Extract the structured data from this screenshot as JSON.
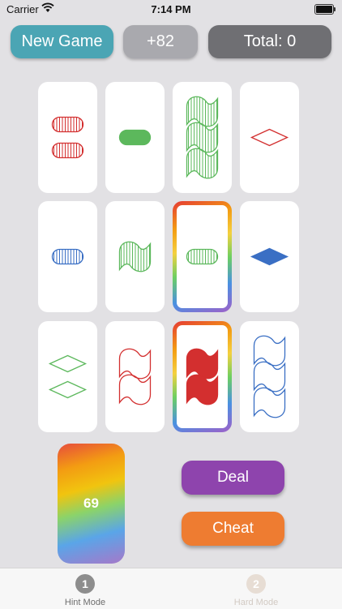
{
  "status_bar": {
    "carrier": "Carrier",
    "time": "7:14 PM"
  },
  "top_bar": {
    "new_game": "New Game",
    "score": "+82",
    "total": "Total: 0"
  },
  "cards": [
    {
      "color": "#d32f2f",
      "shape": "oval",
      "count": 2,
      "fill": "striped",
      "selected": false
    },
    {
      "color": "#5cb85c",
      "shape": "oval",
      "count": 1,
      "fill": "solid",
      "selected": false
    },
    {
      "color": "#5cb85c",
      "shape": "squiggle",
      "count": 3,
      "fill": "striped",
      "selected": false
    },
    {
      "color": "#d32f2f",
      "shape": "diamond",
      "count": 1,
      "fill": "open",
      "selected": false
    },
    {
      "color": "#3a6fc4",
      "shape": "oval",
      "count": 1,
      "fill": "striped",
      "selected": false
    },
    {
      "color": "#5cb85c",
      "shape": "squiggle",
      "count": 1,
      "fill": "striped",
      "selected": false
    },
    {
      "color": "#5cb85c",
      "shape": "oval",
      "count": 1,
      "fill": "striped",
      "selected": true
    },
    {
      "color": "#3a6fc4",
      "shape": "diamond",
      "count": 1,
      "fill": "solid",
      "selected": false
    },
    {
      "color": "#5cb85c",
      "shape": "diamond",
      "count": 2,
      "fill": "open",
      "selected": false
    },
    {
      "color": "#d32f2f",
      "shape": "squiggle",
      "count": 2,
      "fill": "open",
      "selected": false
    },
    {
      "color": "#d32f2f",
      "shape": "squiggle",
      "count": 2,
      "fill": "solid",
      "selected": true
    },
    {
      "color": "#3a6fc4",
      "shape": "squiggle",
      "count": 3,
      "fill": "open",
      "selected": false
    }
  ],
  "deck": {
    "remaining": "69"
  },
  "actions": {
    "deal": "Deal",
    "cheat": "Cheat"
  },
  "tabs": [
    {
      "number": "1",
      "label": "Hint Mode",
      "active": true
    },
    {
      "number": "2",
      "label": "Hard Mode",
      "active": false
    }
  ]
}
